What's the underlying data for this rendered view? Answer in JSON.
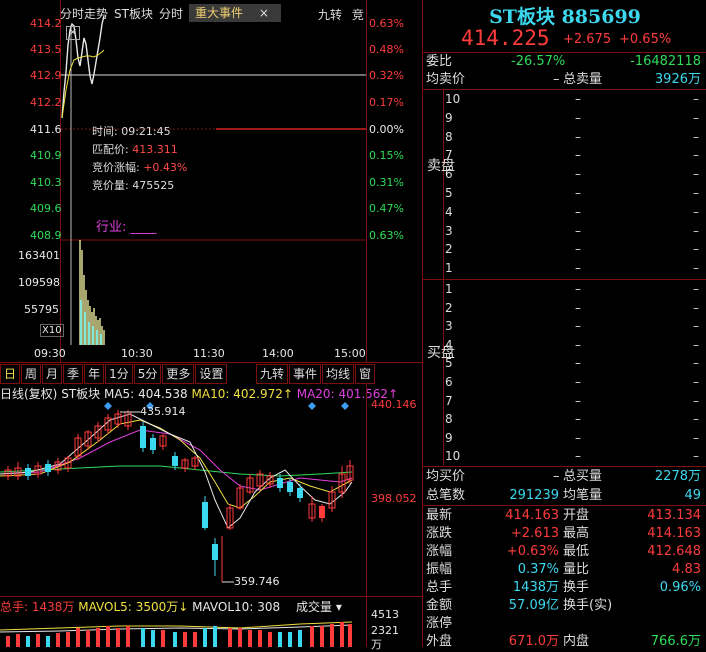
{
  "intraday": {
    "tabs": [
      "分时走势",
      "ST板块",
      "分时"
    ],
    "event_tab": "重大事件",
    "close_symbol": "×",
    "right_tabs": [
      "九转",
      "竞"
    ],
    "price_ticks": [
      "414.2",
      "413.5",
      "412.9",
      "412.2",
      "411.6",
      "410.9",
      "410.3",
      "409.6",
      "408.9"
    ],
    "pct_ticks": [
      "0.63%",
      "0.48%",
      "0.32%",
      "0.17%",
      "0.00%",
      "0.15%",
      "0.31%",
      "0.47%",
      "0.63%"
    ],
    "volume_ticks": [
      "163401",
      "109598",
      "55795"
    ],
    "volume_unit": "X10",
    "time_ticks": [
      "09:30",
      "10:30",
      "11:30",
      "14:00",
      "15:00"
    ],
    "tooltip": {
      "time_label": "时间:",
      "time_value": "09:21:45",
      "match_label": "匹配价:",
      "match_value": "413.311",
      "auction_pct_label": "竞价涨幅:",
      "auction_pct_value": "+0.43%",
      "auction_vol_label": "竞价量:",
      "auction_vol_value": "475525"
    },
    "industry_label": "行业:",
    "industry_value": "____"
  },
  "kline": {
    "toolbar": [
      "日",
      "周",
      "月",
      "季",
      "年",
      "1分",
      "5分",
      "更多",
      "设置"
    ],
    "right_toolbar": [
      "九转",
      "事件",
      "均线",
      "窗"
    ],
    "header_label": "日线(复权)",
    "header_name": "ST板块",
    "ma5_label": "MA5:",
    "ma5_value": "404.538",
    "ma10_label": "MA10:",
    "ma10_value": "402.972",
    "ma20_label": "MA20:",
    "ma20_value": "401.562",
    "high_mark": "435.914",
    "low_mark": "359.746",
    "axis_ticks": [
      "440.146",
      "398.052"
    ],
    "vol_header_label": "总手:",
    "vol_header_value": "1438万",
    "mavol5_label": "MAVOL5:",
    "mavol5_value": "3500万",
    "mavol10_label": "MAVOL10:",
    "mavol10_value": "308",
    "vol_select": "成交量",
    "vol_ticks": [
      "4513",
      "2321",
      "万"
    ],
    "colors": {
      "up": "#ff3c3c",
      "down": "#2fdce8",
      "ma5": "#e8e8e8",
      "ma10": "#f0e040",
      "ma20": "#e040e0",
      "ma60": "#2fdc5a"
    }
  },
  "quote": {
    "name": "ST板块",
    "code": "885699",
    "price": "414.225",
    "change": "+2.675",
    "change_pct": "+0.65%",
    "weibi_label": "委比",
    "weibi_pct": "-26.57%",
    "weibi_diff": "-16482118",
    "ask_avg_label": "均卖价",
    "ask_avg_value": "–",
    "ask_total_label": "总卖量",
    "ask_total_value": "3926万",
    "sell_label": "卖盘",
    "buy_label": "买盘",
    "sell_levels": [
      "10",
      "9",
      "8",
      "7",
      "6",
      "5",
      "4",
      "3",
      "2",
      "1"
    ],
    "buy_levels": [
      "1",
      "2",
      "3",
      "4",
      "5",
      "6",
      "7",
      "8",
      "9",
      "10"
    ],
    "dash": "–",
    "bid_avg_label": "均买价",
    "bid_avg_value": "–",
    "bid_total_label": "总买量",
    "bid_total_value": "2278万",
    "trades_label": "总笔数",
    "trades_value": "291239",
    "avg_per_trade_label": "均笔量",
    "avg_per_trade_value": "49",
    "stats": [
      {
        "l1": "最新",
        "v1": "414.163",
        "c1": "red",
        "l2": "开盘",
        "v2": "413.134",
        "c2": "red"
      },
      {
        "l1": "涨跌",
        "v1": "+2.613",
        "c1": "red",
        "l2": "最高",
        "v2": "414.163",
        "c2": "red"
      },
      {
        "l1": "涨幅",
        "v1": "+0.63%",
        "c1": "red",
        "l2": "最低",
        "v2": "412.648",
        "c2": "red"
      },
      {
        "l1": "振幅",
        "v1": "0.37%",
        "c1": "cyan",
        "l2": "量比",
        "v2": "4.83",
        "c2": "red"
      },
      {
        "l1": "总手",
        "v1": "1438万",
        "c1": "cyan",
        "l2": "换手",
        "v2": "0.96%",
        "c2": "cyan"
      },
      {
        "l1": "金额",
        "v1": "57.09亿",
        "c1": "cyan",
        "l2": "换手(实)",
        "v2": "",
        "c2": "cyan"
      },
      {
        "l1": "涨停",
        "v1": "",
        "c1": "red",
        "l2": "",
        "v2": "",
        "c2": "red"
      },
      {
        "l1": "外盘",
        "v1": "671.0万",
        "c1": "red",
        "l2": "内盘",
        "v2": "766.6万",
        "c2": "grn"
      }
    ]
  }
}
